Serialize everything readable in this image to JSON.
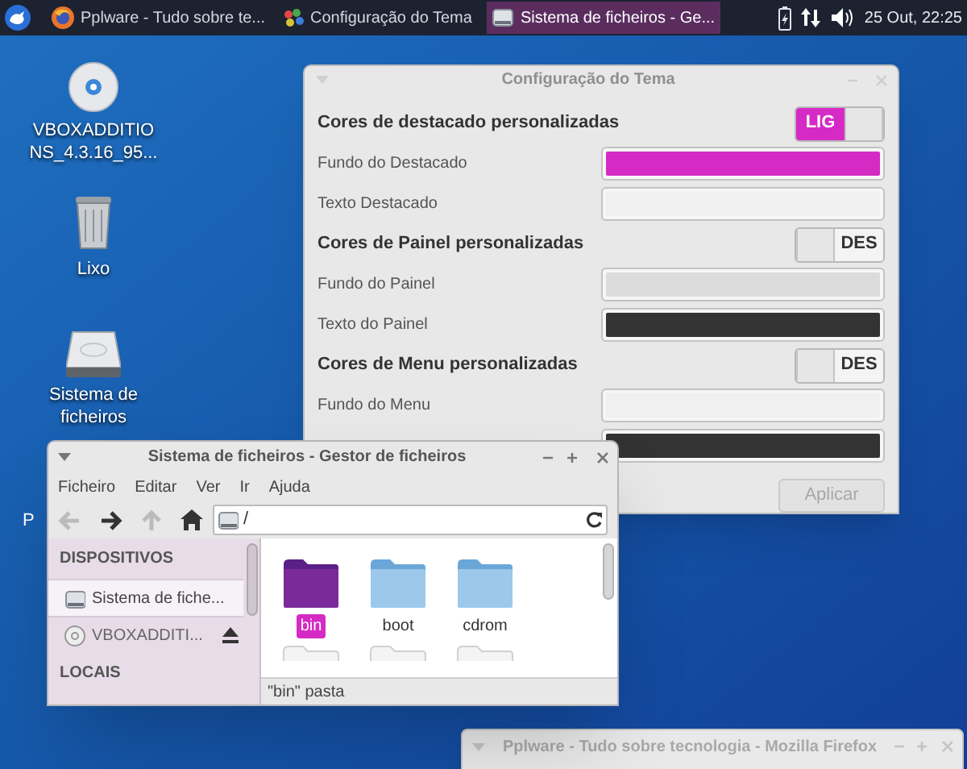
{
  "panel": {
    "tasks": [
      {
        "label": "Pplware - Tudo sobre te...",
        "kind": "browser",
        "selected": false
      },
      {
        "label": "Configuração do Tema",
        "kind": "palette",
        "selected": false
      },
      {
        "label": "Sistema de ficheiros - Ge...",
        "kind": "drive",
        "selected": true
      }
    ],
    "clock": "25 Out, 22:25"
  },
  "desktop_icons": [
    {
      "kind": "disc",
      "lines": [
        "VBOXADDITIO",
        "NS_4.3.16_95..."
      ]
    },
    {
      "kind": "trash",
      "lines": [
        "Lixo"
      ]
    },
    {
      "kind": "drive",
      "lines": [
        "Sistema de",
        "ficheiros"
      ]
    },
    {
      "kind": "hidden",
      "lines": [
        "P"
      ]
    }
  ],
  "theme_window": {
    "title": "Configuração do Tema",
    "rows": [
      {
        "kind": "header",
        "label": "Cores de destacado personalizadas",
        "toggle": "LIG",
        "on": true
      },
      {
        "kind": "color",
        "label": "Fundo do Destacado",
        "color": "#d62ac4"
      },
      {
        "kind": "color",
        "label": "Texto Destacado",
        "color": "#f0f0f0"
      },
      {
        "kind": "header",
        "label": "Cores de Painel personalizadas",
        "toggle": "DES",
        "on": false
      },
      {
        "kind": "color",
        "label": "Fundo do Painel",
        "color": "#dcdcdc"
      },
      {
        "kind": "color",
        "label": "Texto do Painel",
        "color": "#333333"
      },
      {
        "kind": "header",
        "label": "Cores de Menu personalizadas",
        "toggle": "DES",
        "on": false
      },
      {
        "kind": "color",
        "label": "Fundo do Menu",
        "color": "#f0f0f0"
      },
      {
        "kind": "color",
        "color": "#333333"
      }
    ],
    "apply": {
      "label": "Aplicar",
      "disabled": true
    }
  },
  "file_manager": {
    "title": "Sistema de ficheiros - Gestor de ficheiros",
    "menu": [
      "Ficheiro",
      "Editar",
      "Ver",
      "Ir",
      "Ajuda"
    ],
    "path": "/",
    "sidebar": [
      {
        "heading": "DISPOSITIVOS",
        "items": [
          {
            "label": "Sistema de fiche...",
            "kind": "drive",
            "selected": true,
            "eject": false
          },
          {
            "label": "VBOXADDITI...",
            "kind": "disc",
            "selected": false,
            "eject": true
          }
        ]
      },
      {
        "heading": "LOCAIS"
      }
    ],
    "files": [
      {
        "name": "bin",
        "selected": true
      },
      {
        "name": "boot",
        "selected": false
      },
      {
        "name": "cdrom",
        "selected": false
      }
    ],
    "status": "\"bin\" pasta"
  },
  "browser_window": {
    "title": "Pplware - Tudo sobre tecnologia - Mozilla Firefox"
  }
}
